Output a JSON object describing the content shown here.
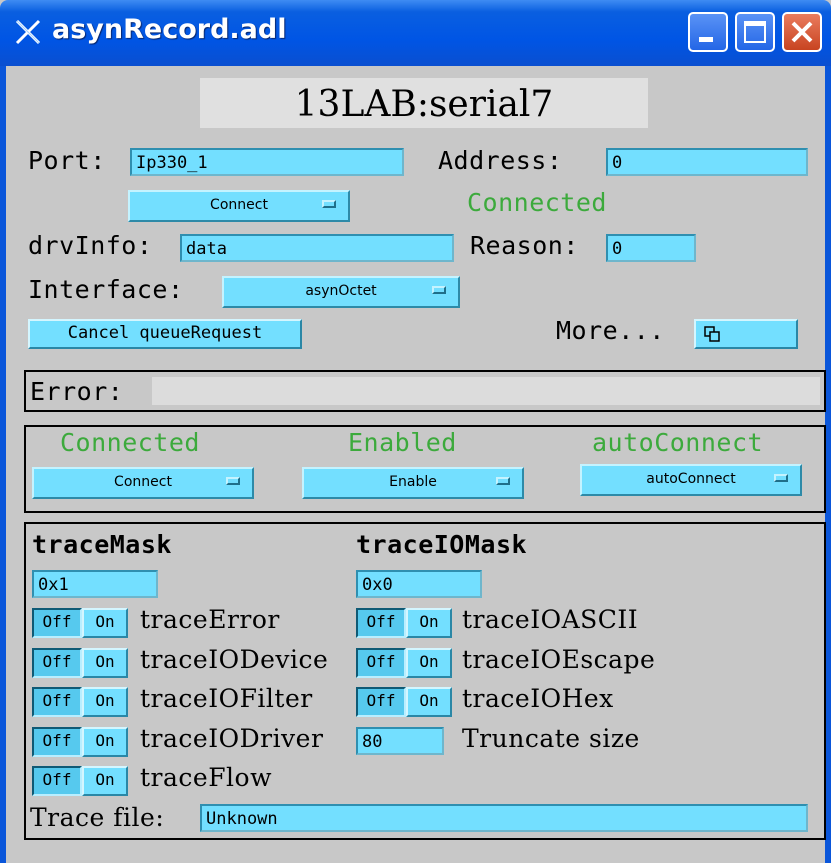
{
  "window": {
    "title": "asynRecord.adl"
  },
  "header": {
    "record_name": "13LAB:serial7"
  },
  "port": {
    "label": "Port:",
    "value": "Ip330_1"
  },
  "address": {
    "label": "Address:",
    "value": "0"
  },
  "connect_menu": {
    "label": "Connect"
  },
  "status_top": "Connected",
  "drvinfo": {
    "label": "drvInfo:",
    "value": "data"
  },
  "reason": {
    "label": "Reason:",
    "value": "0"
  },
  "interface": {
    "label": "Interface:",
    "value": "asynOctet"
  },
  "cancel_button": "Cancel queueRequest",
  "more": {
    "label": "More...",
    "icon": "related-display-icon"
  },
  "error": {
    "label": "Error:",
    "value": ""
  },
  "connection": {
    "connected": {
      "status": "Connected",
      "menu": "Connect"
    },
    "enabled": {
      "status": "Enabled",
      "menu": "Enable"
    },
    "autoconnect": {
      "status": "autoConnect",
      "menu": "autoConnect"
    }
  },
  "trace": {
    "mask_title": "traceMask",
    "mask_value": "0x1",
    "io_mask_title": "traceIOMask",
    "io_mask_value": "0x0",
    "off_label": "Off",
    "on_label": "On",
    "mask_items": [
      {
        "label": "traceError",
        "state": "Off"
      },
      {
        "label": "traceIODevice",
        "state": "Off"
      },
      {
        "label": "traceIOFilter",
        "state": "Off"
      },
      {
        "label": "traceIODriver",
        "state": "Off"
      },
      {
        "label": "traceFlow",
        "state": "Off"
      }
    ],
    "io_mask_items": [
      {
        "label": "traceIOASCII",
        "state": "Off"
      },
      {
        "label": "traceIOEscape",
        "state": "Off"
      },
      {
        "label": "traceIOHex",
        "state": "Off"
      }
    ],
    "truncate_value": "80",
    "truncate_label": "Truncate size",
    "file_label": "Trace file:",
    "file_value": "Unknown"
  }
}
